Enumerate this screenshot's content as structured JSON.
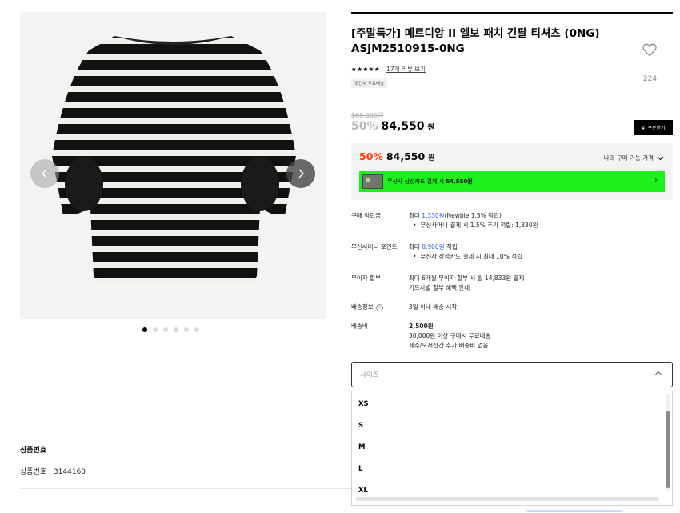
{
  "product": {
    "title": "[주말특가] 메르디앙 II 엘보 패치 긴팔 티셔츠 (0NG) ASJM2510915-0NG",
    "stars": "★★★★★",
    "review_link": "17개 리뷰 보기",
    "shipping_badge": "조건부 무료배송",
    "like_count": "224",
    "original_price": "168,000원",
    "sale_percent": "50%",
    "sale_price": "84,550",
    "won": "원",
    "coupon_button": "쿠폰받기",
    "image_description_icon": "striped-long-sleeve-tshirt"
  },
  "member_price": {
    "percent": "50%",
    "price": "84,550",
    "won": "원",
    "label": "나의 구매 가능 가격",
    "card_text_prefix": "무신사 삼성카드 결제 시 ",
    "card_text_price": "54,550원",
    "banner_color": "#1ef01e",
    "accent_color": "#ff3d00"
  },
  "info": {
    "points": {
      "label": "구매 적립금",
      "line1_prefix": "최대 ",
      "line1_amount": "1,330원",
      "line1_suffix": "(Newbie 1.5% 적립)",
      "line2": "무신사머니 결제 시 1.5% 추가 적립: 1,330원"
    },
    "money_points": {
      "label": "무신사머니 포인트",
      "line1_prefix": "최대 ",
      "line1_amount": "8,900원",
      "line1_suffix": " 적립",
      "line2": "무신사 삼성카드 결제 시 최대 10% 적립"
    },
    "installment": {
      "label": "무이자 할부",
      "line1": "최대 6개월 무이자 할부 시 월 14,833원 결제",
      "line2": "카드사별 할부 혜택 안내"
    },
    "delivery": {
      "label": "배송정보",
      "line1": "3일 이내 배송 시작"
    },
    "shipping_fee": {
      "label": "배송비",
      "line1": "2,500원",
      "line2": "30,000원 이상 구매시 무료배송",
      "line3": "제주/도서산간 추가 배송비 없음"
    }
  },
  "size_select": {
    "placeholder": "사이즈",
    "options": [
      "XS",
      "S",
      "M",
      "L",
      "XL"
    ]
  },
  "product_number": {
    "heading": "상품번호",
    "value": "상품번호 : 3144160"
  },
  "gallery": {
    "dot_count": 6,
    "active_dot": 0
  }
}
